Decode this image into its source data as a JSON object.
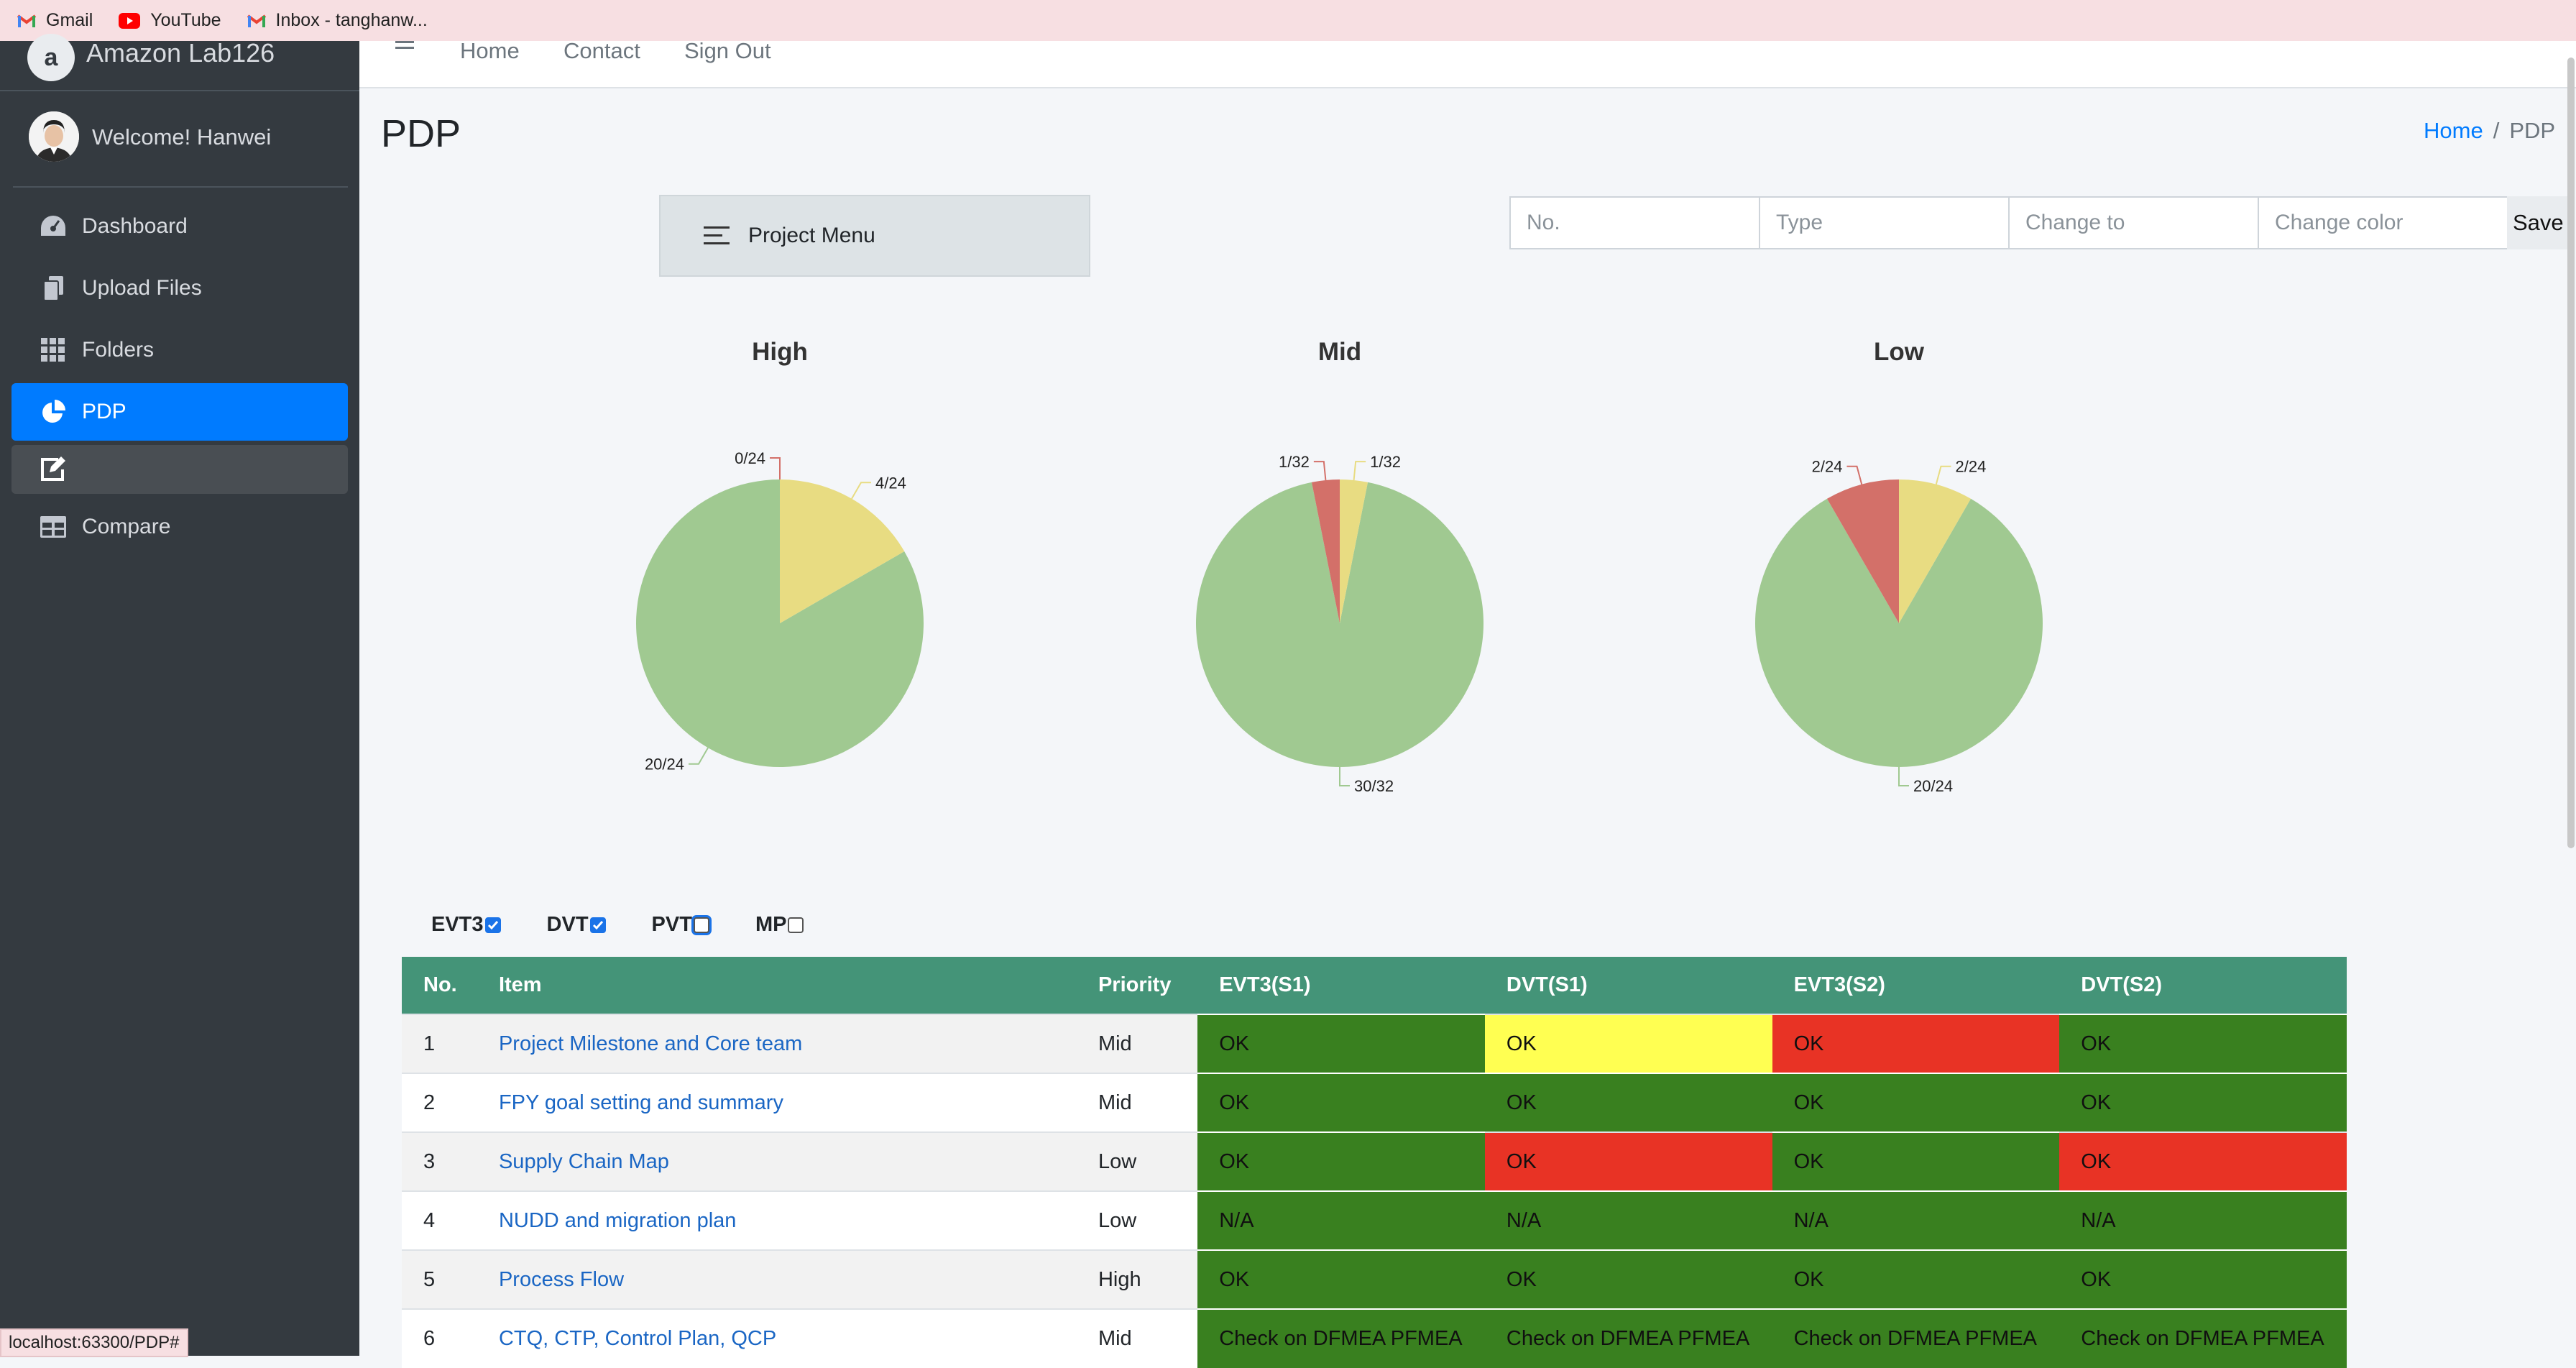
{
  "bookmarks": [
    {
      "label": "Gmail",
      "icon": "gmail-icon"
    },
    {
      "label": "YouTube",
      "icon": "youtube-icon"
    },
    {
      "label": "Inbox - tanghanw...",
      "icon": "gmail-icon"
    }
  ],
  "sidebar": {
    "brand": "Amazon Lab126",
    "brand_logo_letter": "a",
    "welcome": "Welcome! Hanwei",
    "items": [
      {
        "label": "Dashboard",
        "icon": "tachometer-icon"
      },
      {
        "label": "Upload Files",
        "icon": "files-icon"
      },
      {
        "label": "Folders",
        "icon": "grid-icon"
      },
      {
        "label": "PDP",
        "icon": "pie-chart-icon",
        "active": true
      },
      {
        "label": "",
        "icon": "edit-icon"
      },
      {
        "label": "Compare",
        "icon": "table-icon"
      }
    ]
  },
  "topnav": {
    "links": [
      "Home",
      "Contact",
      "Sign Out"
    ]
  },
  "page": {
    "title": "PDP",
    "breadcrumb": {
      "home": "Home",
      "separator": "/",
      "current": "PDP"
    }
  },
  "project_menu": {
    "label": "Project Menu"
  },
  "change_form": {
    "placeholders": [
      "No.",
      "Type",
      "Change to",
      "Change color"
    ],
    "save_label": "Save"
  },
  "colors": {
    "green": "#a0c991",
    "yellow": "#e8dc82",
    "red": "#d37069",
    "table_header": "#449478",
    "ok": "#39801f"
  },
  "chart_data": [
    {
      "type": "pie",
      "title": "High",
      "slices": [
        {
          "label": "0/24",
          "value": 0,
          "color": "#d37069"
        },
        {
          "label": "4/24",
          "value": 4,
          "color": "#e8dc82"
        },
        {
          "label": "20/24",
          "value": 20,
          "color": "#a0c991"
        }
      ]
    },
    {
      "type": "pie",
      "title": "Mid",
      "slices": [
        {
          "label": "1/32",
          "value": 1,
          "color": "#d37069"
        },
        {
          "label": "1/32",
          "value": 1,
          "color": "#e8dc82"
        },
        {
          "label": "30/32",
          "value": 30,
          "color": "#a0c991"
        }
      ]
    },
    {
      "type": "pie",
      "title": "Low",
      "slices": [
        {
          "label": "2/24",
          "value": 2,
          "color": "#d37069"
        },
        {
          "label": "2/24",
          "value": 2,
          "color": "#e8dc82"
        },
        {
          "label": "20/24",
          "value": 20,
          "color": "#a0c991"
        }
      ]
    }
  ],
  "stages": [
    {
      "label": "EVT3",
      "checked": true
    },
    {
      "label": "DVT",
      "checked": true
    },
    {
      "label": "PVT",
      "checked": false,
      "focused": true
    },
    {
      "label": "MP",
      "checked": false
    }
  ],
  "table": {
    "headers": [
      "No.",
      "Item",
      "Priority",
      "EVT3(S1)",
      "DVT(S1)",
      "EVT3(S2)",
      "DVT(S2)"
    ],
    "rows": [
      {
        "no": "1",
        "item": "Project Milestone and Core team",
        "priority": "Mid",
        "cells": [
          {
            "text": "OK",
            "status": "green"
          },
          {
            "text": "OK",
            "status": "yellow"
          },
          {
            "text": "OK",
            "status": "red"
          },
          {
            "text": "OK",
            "status": "green"
          }
        ]
      },
      {
        "no": "2",
        "item": "FPY goal setting and summary",
        "priority": "Mid",
        "cells": [
          {
            "text": "OK",
            "status": "green"
          },
          {
            "text": "OK",
            "status": "green"
          },
          {
            "text": "OK",
            "status": "green"
          },
          {
            "text": "OK",
            "status": "green"
          }
        ]
      },
      {
        "no": "3",
        "item": "Supply Chain Map",
        "priority": "Low",
        "cells": [
          {
            "text": "OK",
            "status": "green"
          },
          {
            "text": "OK",
            "status": "red"
          },
          {
            "text": "OK",
            "status": "green"
          },
          {
            "text": "OK",
            "status": "red"
          }
        ]
      },
      {
        "no": "4",
        "item": "NUDD and migration plan",
        "priority": "Low",
        "cells": [
          {
            "text": "N/A",
            "status": "green"
          },
          {
            "text": "N/A",
            "status": "green"
          },
          {
            "text": "N/A",
            "status": "green"
          },
          {
            "text": "N/A",
            "status": "green"
          }
        ]
      },
      {
        "no": "5",
        "item": "Process Flow",
        "priority": "High",
        "cells": [
          {
            "text": "OK",
            "status": "green"
          },
          {
            "text": "OK",
            "status": "green"
          },
          {
            "text": "OK",
            "status": "green"
          },
          {
            "text": "OK",
            "status": "green"
          }
        ]
      },
      {
        "no": "6",
        "item": "CTQ, CTP, Control Plan, QCP",
        "priority": "Mid",
        "cells": [
          {
            "text": "Check on DFMEA PFMEA",
            "status": "green"
          },
          {
            "text": "Check on DFMEA PFMEA",
            "status": "green"
          },
          {
            "text": "Check on DFMEA PFMEA",
            "status": "green"
          },
          {
            "text": "Check on DFMEA PFMEA",
            "status": "green"
          }
        ]
      }
    ]
  },
  "status_url": "localhost:63300/PDP#"
}
